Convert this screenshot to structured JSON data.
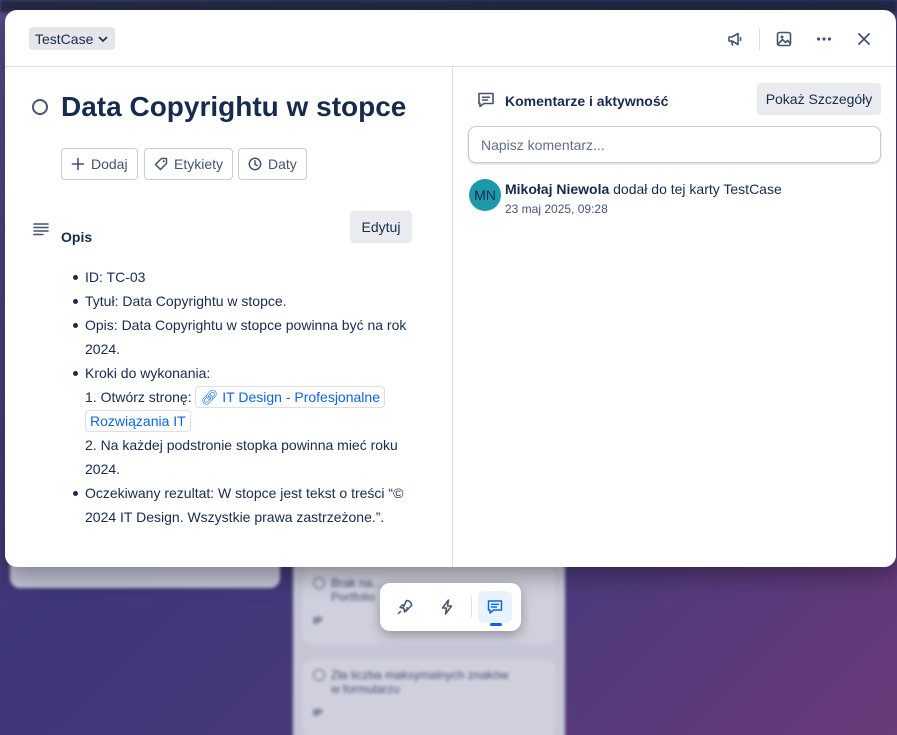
{
  "background": {
    "cards": [
      {
        "title_line1": "Brak na…",
        "title_line2": "Portfolio",
        "tag": "IP"
      },
      {
        "title_line1": "Zła liczba maksymalnych znaków",
        "title_line2": "w formularzu",
        "tag": "IP"
      }
    ]
  },
  "modal": {
    "list_name": "TestCase",
    "header_icons": [
      "megaphone-icon",
      "image-icon",
      "more-icon",
      "close-icon"
    ],
    "card_title": "Data Copyrightu w stopce",
    "actions": {
      "add": "Dodaj",
      "labels": "Etykiety",
      "dates": "Daty"
    },
    "description": {
      "heading": "Opis",
      "edit_label": "Edytuj",
      "items": {
        "id": "ID: TC-03",
        "title": "Tytuł: Data Copyrightu w stopce.",
        "desc": "Opis: Data Copyrightu w stopce powinna być na rok 2024.",
        "steps_heading": "Kroki do wykonania:",
        "step1_prefix": "1. Otwórz stronę:",
        "step1_link": "IT Design - Profesjonalne Rozwiązania IT",
        "step2": "2. Na każdej podstronie stopka powinna mieć roku 2024.",
        "expected": "Oczekiwany rezultat: W stopce jest tekst o treści “© 2024 IT Design. Wszystkie prawa zastrzeżone.”."
      }
    },
    "comments": {
      "heading": "Komentarze i aktywność",
      "details_button": "Pokaż Szczegóły",
      "input_placeholder": "Napisz komentarz...",
      "activity": {
        "avatar_initials": "MN",
        "avatar_color": "#1d9aaa",
        "user": "Mikołaj Niewola",
        "action": "dodał do tej karty TestCase",
        "time": "23 maj 2025, 09:28"
      }
    }
  },
  "bottom_toolbar": {
    "buttons": [
      "rocket-icon",
      "bolt-icon",
      "comment-icon"
    ],
    "active": "comment-icon"
  },
  "colors": {
    "accent": "#0c66e4",
    "text": "#172b4d",
    "muted": "#44546f"
  }
}
